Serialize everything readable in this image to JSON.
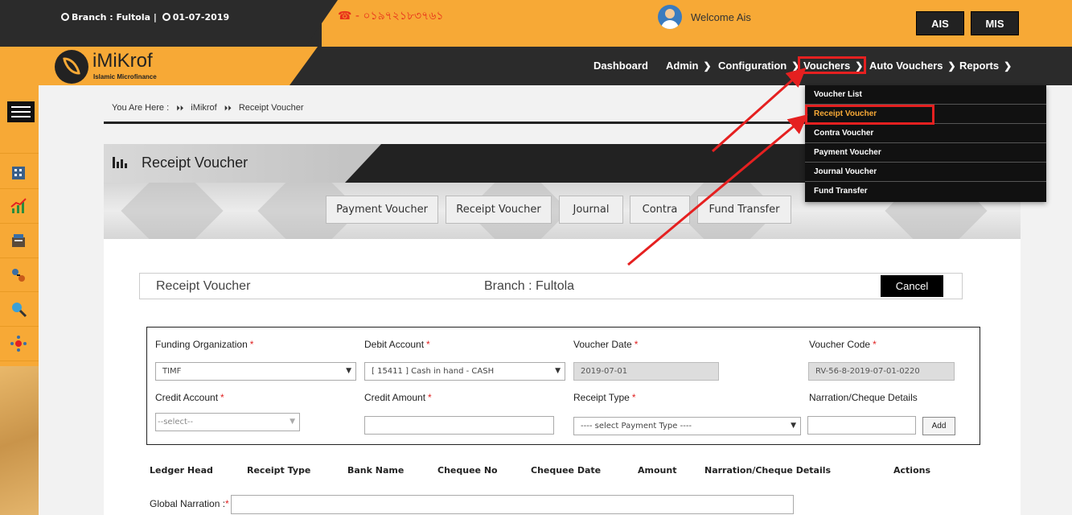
{
  "topbar": {
    "branch_info": "Branch : Fultola |",
    "date": "01-07-2019",
    "phone": "☎ - ০১৯৭২১৮৩৭৬১",
    "welcome": "Welcome Ais",
    "ais_label": "AIS",
    "mis_label": "MIS"
  },
  "logo": {
    "title": "iMiKrof",
    "subtitle": "Islamic Microfinance"
  },
  "nav": {
    "dashboard": "Dashboard",
    "admin": "Admin",
    "configuration": "Configuration",
    "vouchers": "Vouchers",
    "auto_vouchers": "Auto Vouchers",
    "reports": "Reports"
  },
  "dropdown": {
    "items": [
      "Voucher List",
      "Receipt Voucher",
      "Contra Voucher",
      "Payment Voucher",
      "Journal Voucher",
      "Fund Transfer"
    ]
  },
  "breadcrumb": {
    "you_are_here": "You Are Here :",
    "level1": "iMikrof",
    "level2": "Receipt Voucher"
  },
  "panel": {
    "title": "Receipt Voucher"
  },
  "tabs": [
    "Payment Voucher",
    "Receipt Voucher",
    "Journal",
    "Contra",
    "Fund Transfer"
  ],
  "form_head": {
    "title": "Receipt Voucher",
    "branch": "Branch : Fultola",
    "cancel": "Cancel"
  },
  "form": {
    "funding_org_label": "Funding Organization",
    "funding_org_value": "TIMF",
    "debit_account_label": "Debit Account",
    "debit_account_value": "[ 15411 ] Cash in hand - CASH",
    "voucher_date_label": "Voucher Date",
    "voucher_date_value": "2019-07-01",
    "voucher_code_label": "Voucher Code",
    "voucher_code_value": "RV-56-8-2019-07-01-0220",
    "credit_account_label": "Credit Account",
    "credit_account_value": "--select--",
    "credit_amount_label": "Credit Amount",
    "credit_amount_value": "",
    "receipt_type_label": "Receipt Type",
    "receipt_type_value": "---- select Payment Type ----",
    "narration_label": "Narration/Cheque Details",
    "narration_value": "",
    "add": "Add",
    "required_mark": "*"
  },
  "table": {
    "headers": [
      "Ledger Head",
      "Receipt Type",
      "Bank Name",
      "Chequee No",
      "Chequee Date",
      "Amount",
      "Narration/Cheque Details",
      "Actions"
    ]
  },
  "global_narration": {
    "label": "Global Narration :",
    "required": "*"
  },
  "colors": {
    "accent": "#f7a936",
    "dark": "#2b2b2b",
    "highlight": "#e52020"
  }
}
